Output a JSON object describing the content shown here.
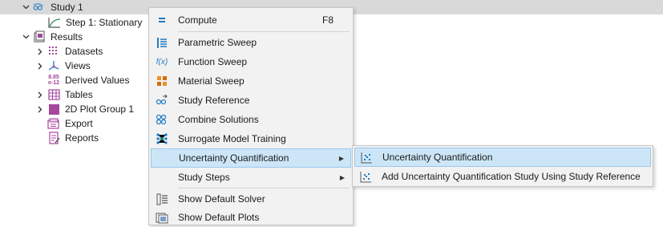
{
  "tree": {
    "study": "Study 1",
    "step": "Step 1: Stationary",
    "results": "Results",
    "datasets": "Datasets",
    "views": "Views",
    "derived_values": "Derived Values",
    "derived_values_icon_text": "8.85 e-12",
    "tables": "Tables",
    "plot_group": "2D Plot Group 1",
    "export": "Export",
    "reports": "Reports"
  },
  "menu": {
    "compute": "Compute",
    "compute_shortcut": "F8",
    "parametric_sweep": "Parametric Sweep",
    "function_sweep": "Function Sweep",
    "function_sweep_icon_text": "f(x)",
    "material_sweep": "Material Sweep",
    "study_reference": "Study Reference",
    "combine_solutions": "Combine Solutions",
    "surrogate_model_training": "Surrogate Model Training",
    "uncertainty_quantification": "Uncertainty Quantification",
    "study_steps": "Study Steps",
    "show_default_solver": "Show Default Solver",
    "show_default_plots": "Show Default Plots"
  },
  "submenu": {
    "uq": "Uncertainty Quantification",
    "add_uq": "Add Uncertainty Quantification Study Using Study Reference"
  },
  "colors": {
    "highlight": "#cde6f7",
    "highlight_border": "#99c9ef",
    "menu_bg": "#f2f2f2",
    "study_row_bg": "#d9d9d9",
    "accent_blue": "#1e7bc4",
    "plot_magenta": "#a5479c",
    "material_orange": "#e8932b"
  }
}
